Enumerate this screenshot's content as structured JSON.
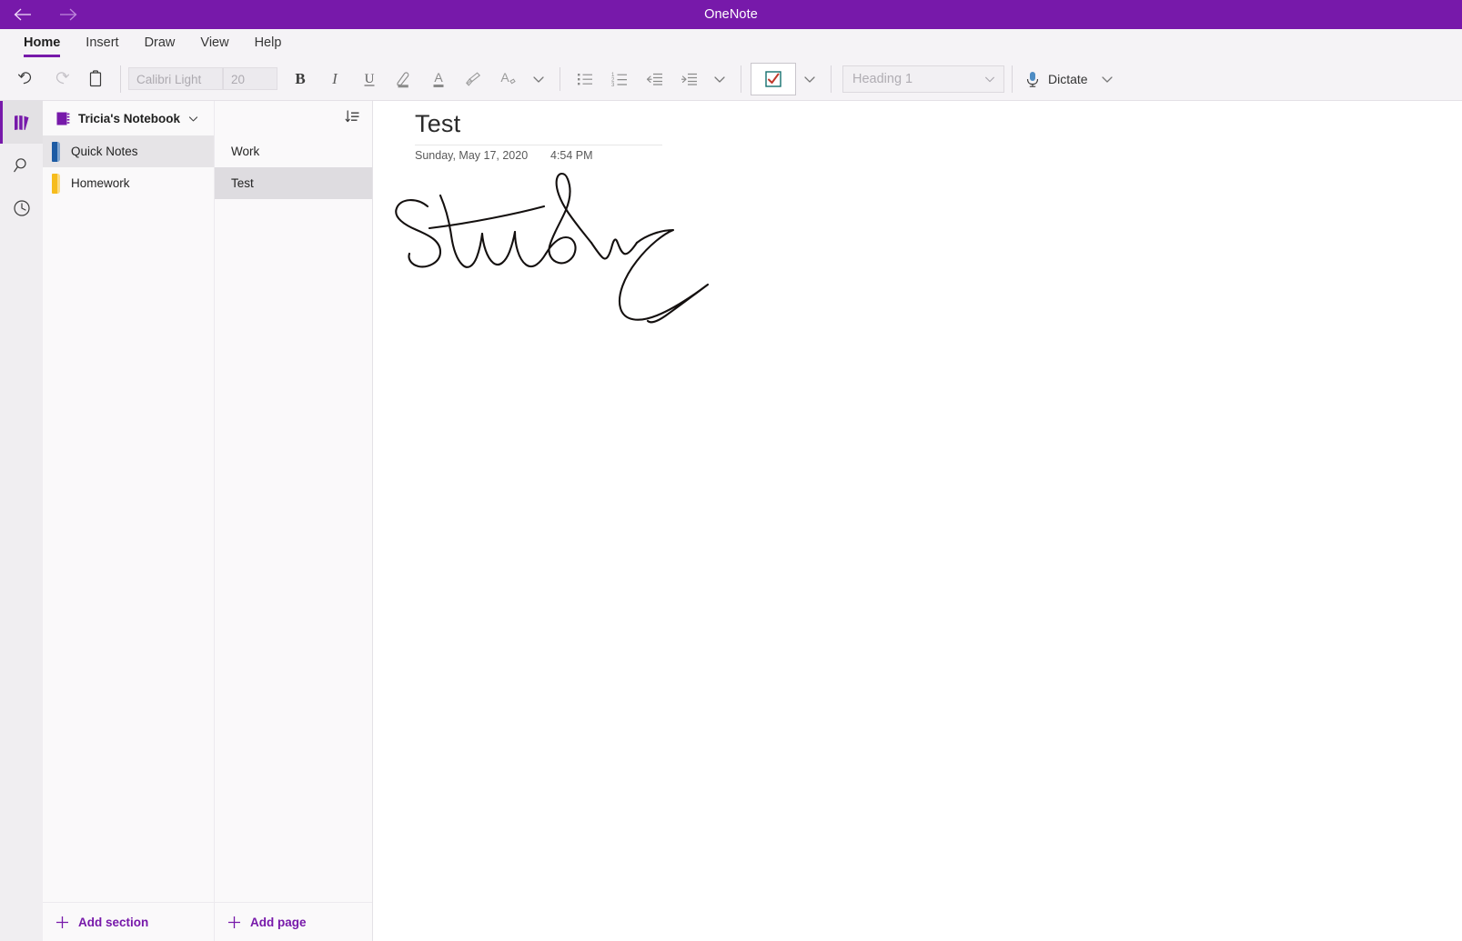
{
  "titlebar": {
    "app_title": "OneNote",
    "back_label": "Back",
    "forward_label": "Forward"
  },
  "ribbon": {
    "tabs": [
      {
        "label": "Home",
        "active": true
      },
      {
        "label": "Insert",
        "active": false
      },
      {
        "label": "Draw",
        "active": false
      },
      {
        "label": "View",
        "active": false
      },
      {
        "label": "Help",
        "active": false
      }
    ],
    "toolbar": {
      "undo": "Undo",
      "redo": "Redo",
      "clipboard": "Paste",
      "font_name": "Calibri Light",
      "font_size": "20",
      "bold": "B",
      "italic": "I",
      "underline": "U",
      "highlight": "Text Highlight Color",
      "font_color": "Font Color",
      "format_painter": "Format Painter",
      "clear_formatting": "Clear Formatting",
      "more_font_options": "More",
      "bullets": "Bullets",
      "numbering": "Numbering",
      "decrease_indent": "Decrease Indent",
      "increase_indent": "Increase Indent",
      "more_paragraph_options": "More",
      "todo_tag": "To Do Tag",
      "todo_tag_dropdown": "Tags",
      "style": "Heading 1",
      "style_dropdown": "Styles",
      "dictate": "Dictate",
      "dictate_dropdown": "Dictate Options"
    }
  },
  "rail": {
    "notebooks": "Notebooks",
    "search": "Search",
    "recent": "Recent Notes"
  },
  "sections": {
    "notebook_name": "Tricia's Notebook",
    "notebook_dropdown": "Notebook list",
    "items": [
      {
        "name": "Quick Notes",
        "color": "#1d5ba4",
        "selected": true
      },
      {
        "name": "Homework",
        "color": "#f6bc1c",
        "selected": false
      }
    ],
    "add_section": "Add section"
  },
  "pages": {
    "sort_label": "Sort pages",
    "items": [
      {
        "name": "Work",
        "selected": false
      },
      {
        "name": "Test",
        "selected": true
      }
    ],
    "add_page": "Add page"
  },
  "canvas": {
    "title": "Test",
    "date": "Sunday, May 17, 2020",
    "time": "4:54 PM",
    "ink_note": "Study",
    "ink_color": "#14100f"
  },
  "colors": {
    "brand_purple": "#7719aa",
    "titlebar": "#7719aa",
    "ribbon_bg": "#f5f3f6",
    "selection": "#e6e4e7"
  }
}
